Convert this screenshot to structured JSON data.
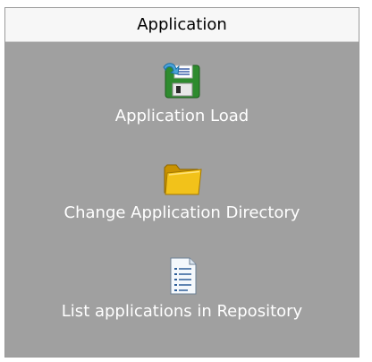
{
  "panel": {
    "title": "Application",
    "items": [
      {
        "label": "Application Load",
        "icon": "floppy-disk-icon"
      },
      {
        "label": "Change Application Directory",
        "icon": "folder-icon"
      },
      {
        "label": "List applications in Repository",
        "icon": "document-list-icon"
      }
    ]
  },
  "colors": {
    "panel_background": "#a0a0a0",
    "header_background": "#f7f7f7",
    "label_text": "#ffffff"
  }
}
